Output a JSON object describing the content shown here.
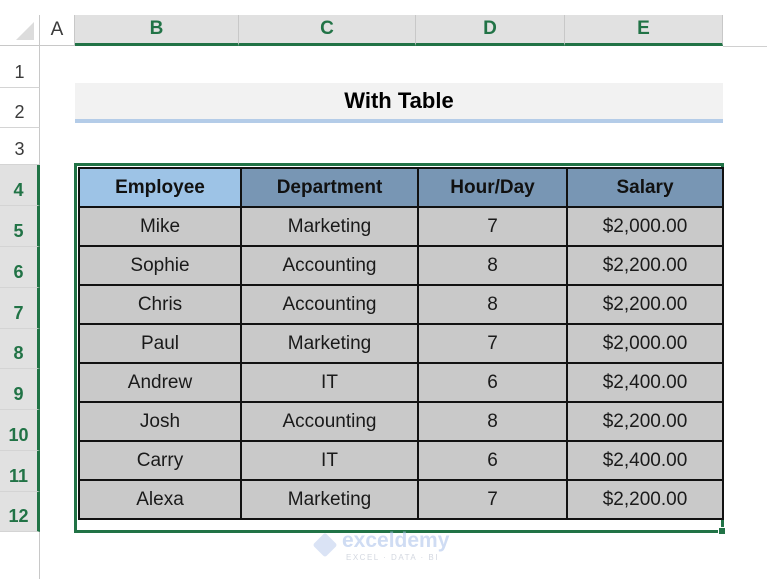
{
  "sheet": {
    "columns": [
      "A",
      "B",
      "C",
      "D",
      "E"
    ],
    "rows": [
      "1",
      "2",
      "3",
      "4",
      "5",
      "6",
      "7",
      "8",
      "9",
      "10",
      "11",
      "12"
    ],
    "title": "With Table",
    "table": {
      "headers": [
        "Employee",
        "Department",
        "Hour/Day",
        "Salary"
      ],
      "rows": [
        [
          "Mike",
          "Marketing",
          "7",
          "$2,000.00"
        ],
        [
          "Sophie",
          "Accounting",
          "8",
          "$2,200.00"
        ],
        [
          "Chris",
          "Accounting",
          "8",
          "$2,200.00"
        ],
        [
          "Paul",
          "Marketing",
          "7",
          "$2,000.00"
        ],
        [
          "Andrew",
          "IT",
          "6",
          "$2,400.00"
        ],
        [
          "Josh",
          "Accounting",
          "8",
          "$2,200.00"
        ],
        [
          "Carry",
          "IT",
          "6",
          "$2,400.00"
        ],
        [
          "Alexa",
          "Marketing",
          "7",
          "$2,200.00"
        ]
      ]
    }
  },
  "watermark": {
    "brand": "exceldemy",
    "tagline": "EXCEL · DATA · BI"
  },
  "colors": {
    "selection_green": "#217346",
    "header_blue": "#9dc3e6",
    "header_steel": "#7896b4",
    "cell_gray": "#c9c9c9"
  }
}
